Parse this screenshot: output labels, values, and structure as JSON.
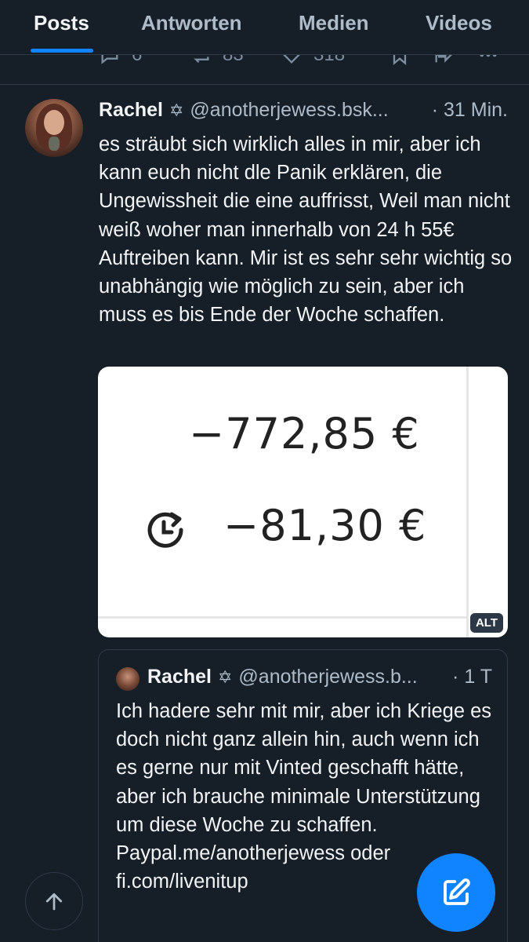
{
  "tabs": [
    {
      "label": "Posts",
      "active": true
    },
    {
      "label": "Antworten",
      "active": false
    },
    {
      "label": "Medien",
      "active": false
    },
    {
      "label": "Videos",
      "active": false
    }
  ],
  "previous_post": {
    "reply_count": "6",
    "repost_count": "83",
    "like_count": "318"
  },
  "post": {
    "author_name": "Rachel",
    "author_badge": "✡",
    "handle": "@anotherjewess.bsk...",
    "time": "· 31 Min.",
    "text": "es sträubt sich wirklich alles in mir, aber ich kann euch nicht dle Panik erklären, die Ungewissheit die eine auffrisst, Weil man nicht weiß woher man innerhalb von 24 h 55€ Auftreiben kann. Mir ist es sehr sehr wichtig so unabhängig wie möglich zu sein, aber ich muss es bis Ende der Woche schaffen.",
    "image": {
      "amount_balance": "−772,85 €",
      "amount_pending": "−81,30 €",
      "alt_badge": "ALT"
    }
  },
  "quoted_post": {
    "author_name": "Rachel",
    "author_badge": "✡",
    "handle": "@anotherjewess.b...",
    "time": "· 1 T",
    "text": "Ich hadere sehr mit mir, aber ich Kriege es doch nicht ganz allein hin, auch wenn ich es gerne nur mit Vinted geschafft hätte, aber ich brauche minimale Unterstützung um diese Woche zu schaffen. Paypal.me/anotherjewess oder fi.com/livenitup"
  },
  "colors": {
    "background": "#161e27",
    "accent": "#1083fe",
    "text_primary": "#f1f3f5",
    "text_secondary": "#aebbc9",
    "divider": "#2e3a48"
  },
  "icons": {
    "compose": "pen-square-icon",
    "scroll_top": "arrow-up-icon"
  }
}
